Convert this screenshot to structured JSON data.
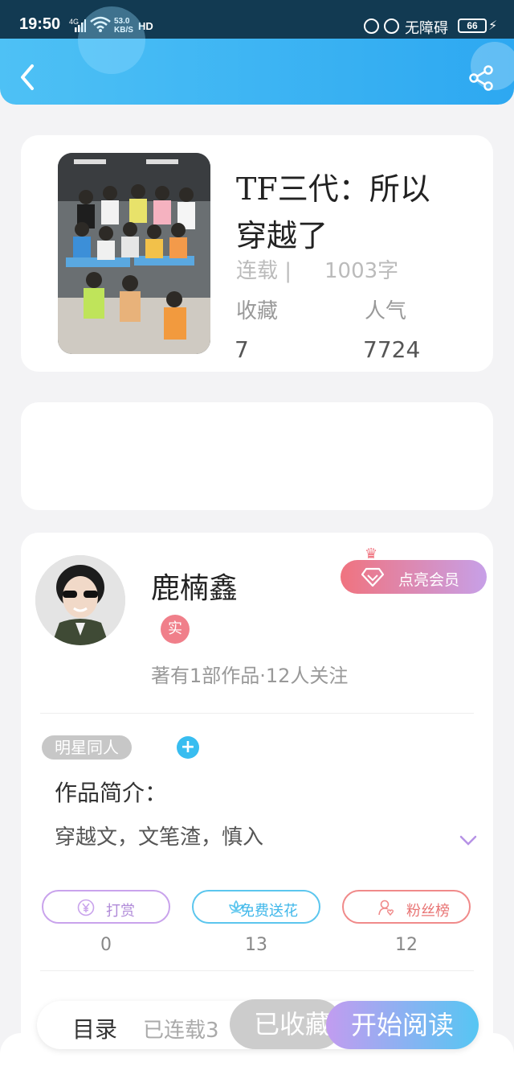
{
  "status_bar": {
    "time": "19:50",
    "network": "4G",
    "speed_value": "53.0",
    "speed_unit": "KB/S",
    "hd": "HD",
    "accessibility": "无障碍",
    "battery": "66"
  },
  "header": {
    "back_icon": "chevron-left-icon",
    "share_icon": "share-icon"
  },
  "book": {
    "title": "TF三代：所以穿越了",
    "serial_status": "连载 |",
    "word_count": "1003字",
    "favorites_label": "收藏",
    "popularity_label": "人气",
    "favorites_value": "7",
    "popularity_value": "7724"
  },
  "author": {
    "name": "鹿楠鑫",
    "verified_badge": "实",
    "vip_button": "点亮会员",
    "meta": "著有1部作品·12人关注"
  },
  "work": {
    "tag": "明星同人",
    "add_tag": "+",
    "intro_title": "作品简介：",
    "intro_text": "穿越文，文笔渣，慎入"
  },
  "actions": [
    {
      "label": "打赏",
      "count": "0",
      "icon": "yen-icon"
    },
    {
      "label": "免费送花",
      "count": "13",
      "icon": "flower-icon"
    },
    {
      "label": "粉丝榜",
      "count": "12",
      "icon": "user-heart-icon"
    }
  ],
  "bottom_bar": {
    "catalog": "目录",
    "serial_info": "已连载3",
    "collected": "已收藏",
    "start_reading": "开始阅读"
  },
  "colors": {
    "header_start": "#4ec1f5",
    "header_end": "#2da8f1",
    "vip_start": "#f0737f",
    "vip_end": "#c7a0e8",
    "read_start": "#c29cf0",
    "read_end": "#56c6f3"
  }
}
